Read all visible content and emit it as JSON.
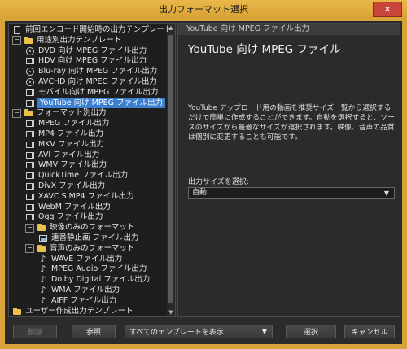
{
  "window": {
    "title": "出力フォーマット選択",
    "close_glyph": "✕"
  },
  "tree": {
    "items": [
      {
        "label": "前回エンコード開始時の出力テンプレート",
        "icon": "doc-icon"
      },
      {
        "label": "用途別出力テンプレート",
        "icon": "folder-icon",
        "expander": "−"
      },
      {
        "label": "DVD 向け MPEG ファイル出力",
        "icon": "disc-icon"
      },
      {
        "label": "HDV 向け MPEG ファイル出力",
        "icon": "film-icon"
      },
      {
        "label": "Blu-ray 向け MPEG ファイル出力",
        "icon": "disc-icon"
      },
      {
        "label": "AVCHD 向け MPEG ファイル出力",
        "icon": "disc-icon"
      },
      {
        "label": "モバイル向け MPEG ファイル出力",
        "icon": "film-icon"
      },
      {
        "label": "YouTube 向け MPEG ファイル出力",
        "icon": "film-icon",
        "selected": true
      },
      {
        "label": "フォーマット別出力",
        "icon": "folder-icon",
        "expander": "−"
      },
      {
        "label": "MPEG ファイル出力",
        "icon": "film-icon"
      },
      {
        "label": "MP4 ファイル出力",
        "icon": "film-icon"
      },
      {
        "label": "MKV ファイル出力",
        "icon": "film-icon"
      },
      {
        "label": "AVI ファイル出力",
        "icon": "film-icon"
      },
      {
        "label": "WMV ファイル出力",
        "icon": "film-icon"
      },
      {
        "label": "QuickTime ファイル出力",
        "icon": "film-icon"
      },
      {
        "label": "DivX ファイル出力",
        "icon": "film-icon"
      },
      {
        "label": "XAVC S MP4 ファイル出力",
        "icon": "film-icon"
      },
      {
        "label": "WebM ファイル出力",
        "icon": "film-icon"
      },
      {
        "label": "Ogg ファイル出力",
        "icon": "film-icon"
      },
      {
        "label": "映像のみのフォーマット",
        "icon": "folder-icon",
        "expander": "−"
      },
      {
        "label": "連番静止画 ファイル出力",
        "icon": "image-icon"
      },
      {
        "label": "音声のみのフォーマット",
        "icon": "folder-icon",
        "expander": "−"
      },
      {
        "label": "WAVE ファイル出力",
        "icon": "note-icon"
      },
      {
        "label": "MPEG Audio ファイル出力",
        "icon": "note-icon"
      },
      {
        "label": "Dolby Digital ファイル出力",
        "icon": "note-icon"
      },
      {
        "label": "WMA ファイル出力",
        "icon": "note-icon"
      },
      {
        "label": "AIFF ファイル出力",
        "icon": "note-icon"
      },
      {
        "label": "ユーザー作成出力テンプレート",
        "icon": "folder-icon"
      }
    ]
  },
  "detail": {
    "header": "YouTube 向け MPEG ファイル出力",
    "title": "YouTube 向け MPEG ファイル",
    "description": "YouTube アップロード用の動画を推奨サイズ一覧から選択するだけで簡単に作成することができます。自動を選択すると、ソースのサイズから最適なサイズが選択されます。映像、音声の品質は個別に変更することも可能です。",
    "size_label": "出力サイズを選択:",
    "size_value": "自動"
  },
  "buttons": {
    "delete": "削除",
    "browse": "参照",
    "template_filter": "すべてのテンプレートを表示",
    "select": "選択",
    "cancel": "キャンセル"
  },
  "colors": {
    "frame": "#d8a33a",
    "selection": "#3a7fd0",
    "panel": "#2b2b2b"
  }
}
